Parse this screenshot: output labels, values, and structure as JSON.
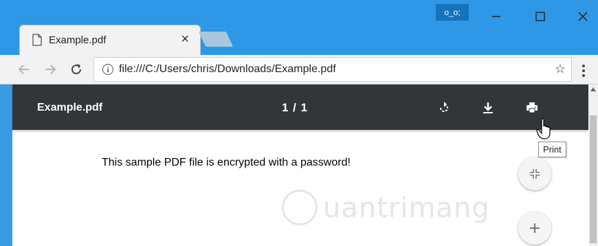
{
  "window": {
    "profile_badge": "o_o;",
    "minimize_label": "—",
    "maximize_label": "☐",
    "close_label": "✕"
  },
  "tab": {
    "title": "Example.pdf",
    "close_label": "×"
  },
  "toolbar": {
    "url": "file:///C:/Users/chris/Downloads/Example.pdf",
    "info_label": "i",
    "bookmark_label": "☆"
  },
  "pdf_viewer": {
    "title": "Example.pdf",
    "page_indicator": "1 / 1",
    "body_text": "This sample PDF file is encrypted with a password!",
    "print_tooltip": "Print"
  },
  "watermark": {
    "text": "uantrimang"
  },
  "colors": {
    "titlebar": "#2e98e6",
    "pdf_toolbar": "#323639",
    "profile_badge_bg": "#1473bb"
  }
}
